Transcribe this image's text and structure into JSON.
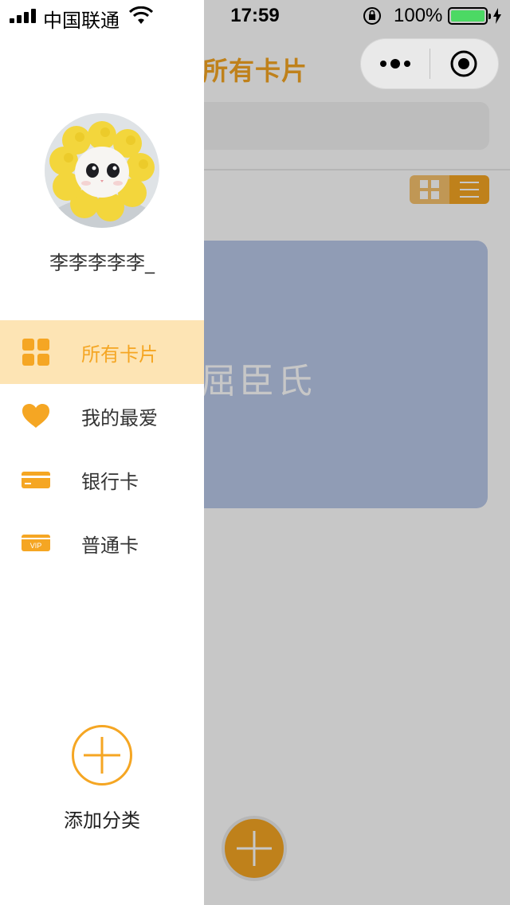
{
  "status_bar": {
    "carrier": "中国联通",
    "time": "17:59",
    "battery_percent": "100%",
    "battery_level": 1.0
  },
  "background_page": {
    "title": "所有卡片",
    "card_name": "屈臣氏",
    "card_color": "#b9c8e8"
  },
  "drawer": {
    "username": "李李李李李_",
    "menu": [
      {
        "label": "所有卡片",
        "icon": "grid-icon",
        "active": true
      },
      {
        "label": "我的最爱",
        "icon": "heart-icon",
        "active": false
      },
      {
        "label": "银行卡",
        "icon": "bank-card-icon",
        "active": false
      },
      {
        "label": "普通卡",
        "icon": "vip-card-icon",
        "active": false
      }
    ],
    "add_category_label": "添加分类"
  },
  "colors": {
    "accent": "#f5a623",
    "active_bg": "#fde4b4",
    "battery_green": "#4cd964"
  }
}
